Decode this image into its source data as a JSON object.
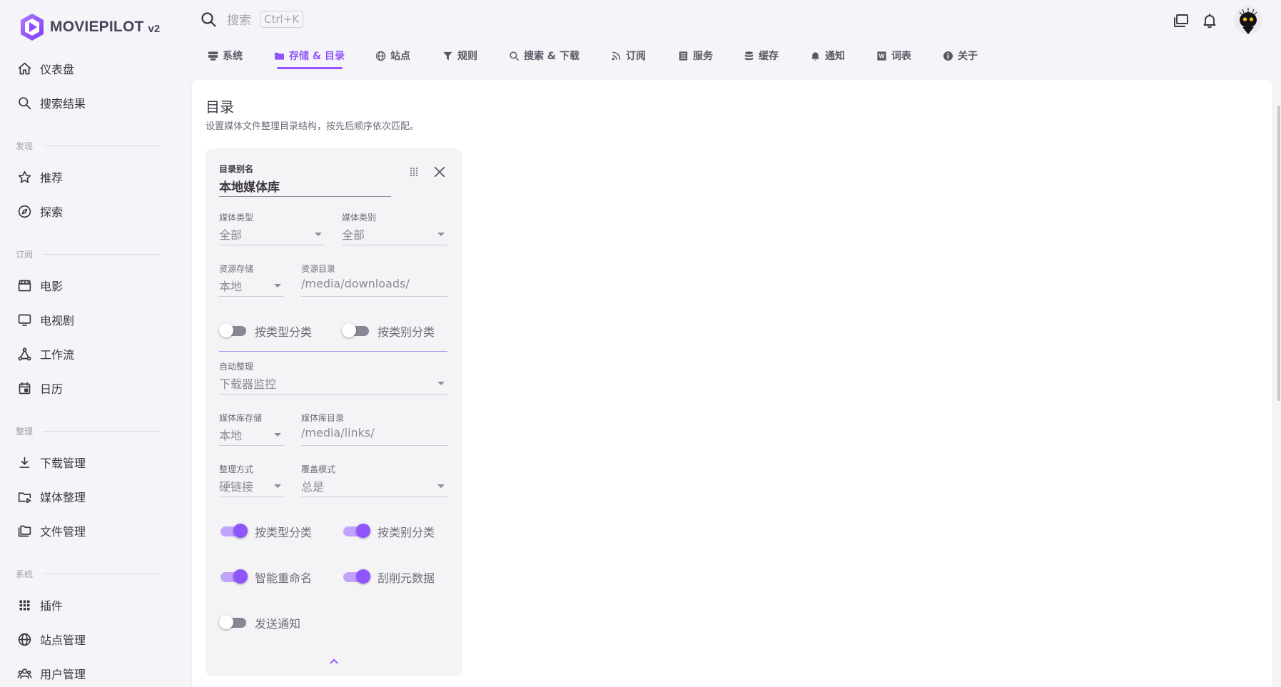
{
  "app": {
    "brand": "MOVIEPILOT",
    "version": "v2"
  },
  "sidebar": {
    "items": [
      {
        "label": "仪表盘",
        "icon": "home-icon"
      },
      {
        "label": "搜索结果",
        "icon": "search-icon"
      },
      {
        "label": "推荐",
        "icon": "star-icon"
      },
      {
        "label": "探索",
        "icon": "compass-icon"
      },
      {
        "label": "电影",
        "icon": "movie-clapper-icon"
      },
      {
        "label": "电视剧",
        "icon": "monitor-icon"
      },
      {
        "label": "工作流",
        "icon": "workflow-icon"
      },
      {
        "label": "日历",
        "icon": "calendar-icon"
      },
      {
        "label": "下载管理",
        "icon": "download-icon"
      },
      {
        "label": "媒体整理",
        "icon": "folder-play-icon"
      },
      {
        "label": "文件管理",
        "icon": "folders-icon"
      },
      {
        "label": "插件",
        "icon": "apps-grid-icon"
      },
      {
        "label": "站点管理",
        "icon": "globe-icon"
      },
      {
        "label": "用户管理",
        "icon": "users-icon"
      }
    ],
    "sections": [
      "发现",
      "订阅",
      "整理",
      "系统"
    ]
  },
  "topbar": {
    "search_placeholder": "搜索",
    "search_shortcut": "Ctrl+K"
  },
  "tabs": [
    {
      "label": "系统",
      "icon": "server-icon"
    },
    {
      "label": "存储 & 目录",
      "icon": "folder-icon",
      "active": true
    },
    {
      "label": "站点",
      "icon": "globe-icon"
    },
    {
      "label": "规则",
      "icon": "filter-icon"
    },
    {
      "label": "搜索 & 下载",
      "icon": "search-icon"
    },
    {
      "label": "订阅",
      "icon": "rss-icon"
    },
    {
      "label": "服务",
      "icon": "list-icon"
    },
    {
      "label": "缓存",
      "icon": "database-icon"
    },
    {
      "label": "通知",
      "icon": "bell-icon"
    },
    {
      "label": "词表",
      "icon": "word-icon"
    },
    {
      "label": "关于",
      "icon": "info-icon"
    }
  ],
  "page": {
    "title": "目录",
    "subtitle": "设置媒体文件整理目录结构，按先后顺序依次匹配。"
  },
  "directory": {
    "alias": {
      "label": "目录别名",
      "value": "本地媒体库"
    },
    "media_type": {
      "label": "媒体类型",
      "value": "全部"
    },
    "media_category": {
      "label": "媒体类别",
      "value": "全部"
    },
    "source_storage": {
      "label": "资源存储",
      "value": "本地"
    },
    "source_dir": {
      "label": "资源目录",
      "value": "/media/downloads/"
    },
    "src_switch_type": {
      "label": "按类型分类",
      "on": false
    },
    "src_switch_category": {
      "label": "按类别分类",
      "on": false
    },
    "auto_organize": {
      "label": "自动整理",
      "value": "下载器监控"
    },
    "library_storage": {
      "label": "媒体库存储",
      "value": "本地"
    },
    "library_dir": {
      "label": "媒体库目录",
      "value": "/media/links/"
    },
    "transfer_mode": {
      "label": "整理方式",
      "value": "硬链接"
    },
    "overwrite_mode": {
      "label": "覆盖模式",
      "value": "总是"
    },
    "lib_switch_type": {
      "label": "按类型分类",
      "on": true
    },
    "lib_switch_category": {
      "label": "按类别分类",
      "on": true
    },
    "smart_rename": {
      "label": "智能重命名",
      "on": true
    },
    "scrape": {
      "label": "刮削元数据",
      "on": true
    },
    "notify": {
      "label": "发送通知",
      "on": false
    }
  },
  "colors": {
    "accent": "#9155fd",
    "accent_light": "#c1a4fb",
    "text": "#3a3541",
    "muted": "#8e8a97"
  }
}
